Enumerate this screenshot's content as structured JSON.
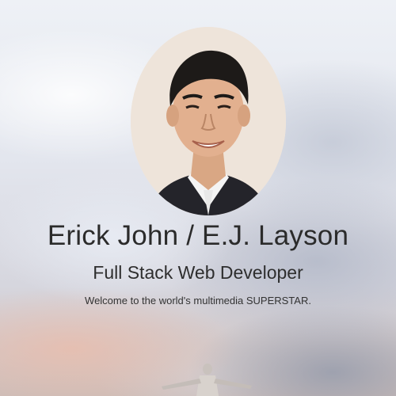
{
  "profile": {
    "name": "Erick John / E.J. Layson",
    "title": "Full Stack Web Developer",
    "tagline": "Welcome to the world's multimedia SUPERSTAR."
  },
  "icons": {
    "portrait": "profile-photo",
    "background": "cloudy-sky-photo"
  },
  "colors": {
    "heading_text": "#2b2b2b",
    "body_text": "#333333"
  }
}
